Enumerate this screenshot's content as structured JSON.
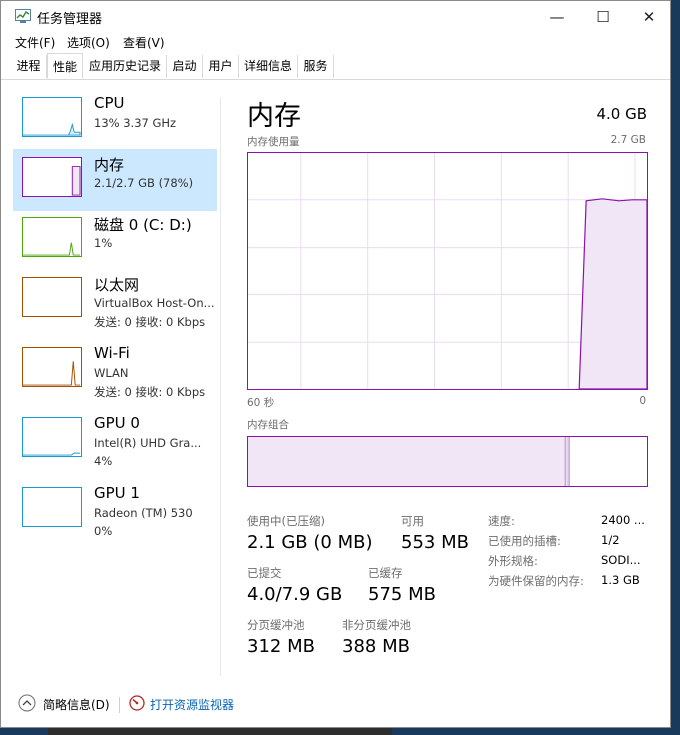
{
  "window": {
    "title": "任务管理器"
  },
  "window_controls": {
    "minimize": "—",
    "maximize": "☐",
    "close": "✕"
  },
  "menu": [
    "文件(F)",
    "选项(O)",
    "查看(V)"
  ],
  "tabs": [
    "进程",
    "性能",
    "应用历史记录",
    "启动",
    "用户",
    "详细信息",
    "服务"
  ],
  "active_tab": "性能",
  "sidebar": [
    {
      "title": "CPU",
      "line1": "13%  3.37 GHz",
      "line2": "",
      "color": "#1a98d3"
    },
    {
      "title": "内存",
      "line1": "2.1/2.7 GB (78%)",
      "line2": "",
      "color": "#8b12ae",
      "selected": true
    },
    {
      "title": "磁盘 0 (C: D:)",
      "line1": "1%",
      "line2": "",
      "color": "#4da60c"
    },
    {
      "title": "以太网",
      "line1": "VirtualBox Host-On...",
      "line2": "发送: 0  接收: 0 Kbps",
      "color": "#a74f01"
    },
    {
      "title": "Wi-Fi",
      "line1": "WLAN",
      "line2": "发送: 0  接收: 0 Kbps",
      "color": "#a74f01"
    },
    {
      "title": "GPU 0",
      "line1": "Intel(R) UHD Gra...",
      "line2": "4%",
      "color": "#1a98d3"
    },
    {
      "title": "GPU 1",
      "line1": "Radeon (TM) 530",
      "line2": "0%",
      "color": "#1a98d3"
    }
  ],
  "main": {
    "title": "内存",
    "total": "4.0 GB",
    "usage_label": "内存使用量",
    "usage_max": "2.7 GB",
    "axis_left": "60 秒",
    "axis_right": "0",
    "composition_label": "内存组合",
    "usage_level": 0.8
  },
  "stats": {
    "in_use_label": "使用中(已压缩)",
    "in_use_value": "2.1 GB (0 MB)",
    "available_label": "可用",
    "available_value": "553 MB",
    "committed_label": "已提交",
    "committed_value": "4.0/7.9 GB",
    "cached_label": "已缓存",
    "cached_value": "575 MB",
    "paged_label": "分页缓冲池",
    "paged_value": "312 MB",
    "nonpaged_label": "非分页缓冲池",
    "nonpaged_value": "388 MB"
  },
  "details": [
    {
      "label": "速度:",
      "value": "2400 ..."
    },
    {
      "label": "已使用的插槽:",
      "value": "1/2"
    },
    {
      "label": "外形规格:",
      "value": "SODI..."
    },
    {
      "label": "为硬件保留的内存:",
      "value": "1.3 GB"
    }
  ],
  "footer": {
    "brief": "简略信息(D)",
    "resource_monitor": "打开资源监视器"
  }
}
